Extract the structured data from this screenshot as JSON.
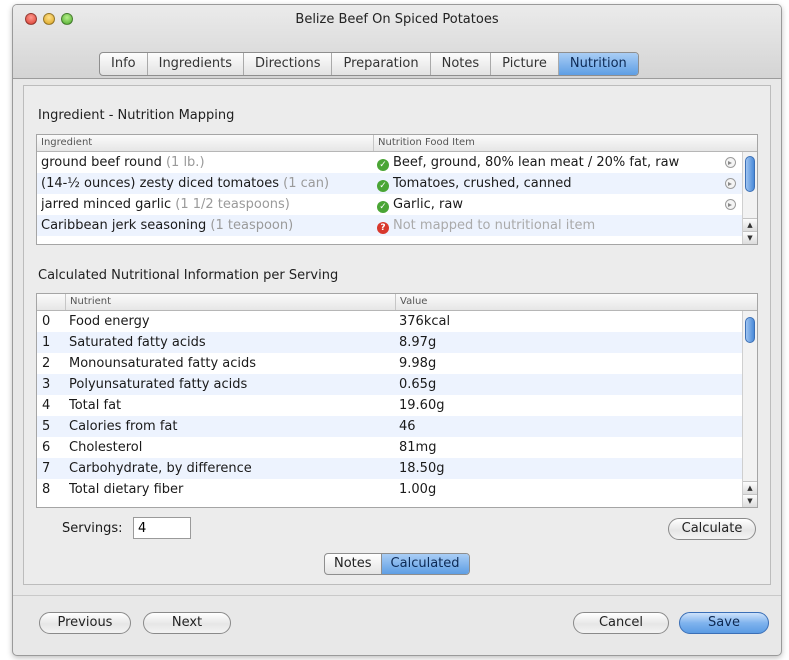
{
  "window": {
    "title": "Belize Beef On Spiced Potatoes"
  },
  "tabs": [
    {
      "label": "Info",
      "active": false
    },
    {
      "label": "Ingredients",
      "active": false
    },
    {
      "label": "Directions",
      "active": false
    },
    {
      "label": "Preparation",
      "active": false
    },
    {
      "label": "Notes",
      "active": false
    },
    {
      "label": "Picture",
      "active": false
    },
    {
      "label": "Nutrition",
      "active": true
    }
  ],
  "mapping": {
    "title": "Ingredient - Nutrition Mapping",
    "columns": {
      "ingredient": "Ingredient",
      "food_item": "Nutrition Food Item"
    },
    "rows": [
      {
        "name": "ground beef round",
        "qty": "(1 lb.)",
        "status": "mapped",
        "item": "Beef, ground, 80% lean meat / 20% fat, raw"
      },
      {
        "name": "(14-½ ounces) zesty diced tomatoes",
        "qty": "(1 can)",
        "status": "mapped",
        "item": "Tomatoes, crushed, canned"
      },
      {
        "name": "jarred minced garlic",
        "qty": "(1 1/2 teaspoons)",
        "status": "mapped",
        "item": "Garlic, raw"
      },
      {
        "name": "Caribbean jerk seasoning",
        "qty": "(1 teaspoon)",
        "status": "unmapped",
        "item": "Not mapped to nutritional item"
      }
    ]
  },
  "nutrition": {
    "title": "Calculated Nutritional Information per Serving",
    "columns": {
      "index": "",
      "nutrient": "Nutrient",
      "value": "Value"
    },
    "rows": [
      {
        "index": "0",
        "nutrient": "Food energy",
        "value": "376kcal"
      },
      {
        "index": "1",
        "nutrient": "Saturated fatty acids",
        "value": "8.97g"
      },
      {
        "index": "2",
        "nutrient": "Monounsaturated fatty acids",
        "value": "9.98g"
      },
      {
        "index": "3",
        "nutrient": "Polyunsaturated fatty acids",
        "value": "0.65g"
      },
      {
        "index": "4",
        "nutrient": "Total fat",
        "value": "19.60g"
      },
      {
        "index": "5",
        "nutrient": "Calories from fat",
        "value": "46"
      },
      {
        "index": "6",
        "nutrient": "Cholesterol",
        "value": "81mg"
      },
      {
        "index": "7",
        "nutrient": "Carbohydrate, by difference",
        "value": "18.50g"
      },
      {
        "index": "8",
        "nutrient": "Total dietary fiber",
        "value": "1.00g"
      }
    ]
  },
  "servings": {
    "label": "Servings:",
    "value": "4"
  },
  "buttons": {
    "calculate": "Calculate",
    "previous": "Previous",
    "next": "Next",
    "cancel": "Cancel",
    "save": "Save"
  },
  "view_toggle": [
    {
      "label": "Notes",
      "active": false
    },
    {
      "label": "Calculated",
      "active": true
    }
  ]
}
